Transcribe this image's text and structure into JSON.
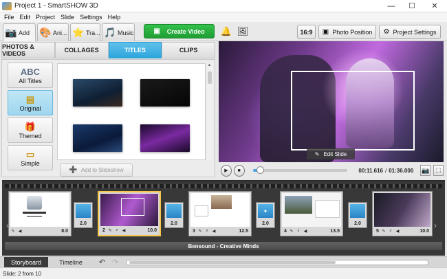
{
  "window": {
    "title": "Project 1 - SmartSHOW 3D",
    "minimize": "—",
    "maximize": "☐",
    "close": "✕"
  },
  "menu": [
    "File",
    "Edit",
    "Project",
    "Slide",
    "Settings",
    "Help"
  ],
  "main_tabs": [
    {
      "label": "Add",
      "icon": "📷"
    },
    {
      "label": "Ani...",
      "icon": "🎨"
    },
    {
      "label": "Tra...",
      "icon": "⭐"
    },
    {
      "label": "Music",
      "icon": "🎵"
    }
  ],
  "toolbar": {
    "create_video": "Create Video",
    "create_video_icon": "▣",
    "bell_icon": "🔔",
    "photo_icon": "🖼",
    "aspect_ratio": "16:9",
    "photo_position": "Photo Position",
    "photo_position_icon": "▣",
    "project_settings": "Project Settings",
    "project_settings_icon": "⚙"
  },
  "category_tabs": [
    {
      "label": "PHOTOS & VIDEOS",
      "active": false
    },
    {
      "label": "COLLAGES",
      "active": false
    },
    {
      "label": "TITLES",
      "active": true
    },
    {
      "label": "CLIPS",
      "active": false
    }
  ],
  "title_categories": [
    {
      "label": "All Titles",
      "icon": "ABC",
      "active": false
    },
    {
      "label": "Original",
      "icon": "▤",
      "active": true
    },
    {
      "label": "Themed",
      "icon": "🎁",
      "active": false
    },
    {
      "label": "Simple",
      "icon": "▭",
      "active": false
    }
  ],
  "add_to_slideshow": "Add to Slideshow",
  "add_to_slideshow_icon": "➕",
  "preview": {
    "edit_slide": "Edit Slide",
    "edit_icon": "✎"
  },
  "player": {
    "play_icon": "▶",
    "stop_icon": "■",
    "progress": 0.074,
    "current_time": "00:11.616",
    "total_time": "01:36.000",
    "separator": "/",
    "snapshot_icon": "📷",
    "fullscreen_icon": "⛶"
  },
  "slides": [
    {
      "number": "1",
      "duration": "8.0"
    },
    {
      "number": "2",
      "duration": "10.0"
    },
    {
      "number": "3",
      "duration": "12.5"
    },
    {
      "number": "4",
      "duration": "13.5"
    },
    {
      "number": "5",
      "duration": "10.0"
    }
  ],
  "transitions": [
    "2.0",
    "2.0",
    "2.0",
    "2.0"
  ],
  "audio_track": "Bensound - Creative Minds",
  "bottom_tabs": {
    "storyboard": "Storyboard",
    "timeline": "Timeline"
  },
  "status": "Slide: 2 from 10"
}
